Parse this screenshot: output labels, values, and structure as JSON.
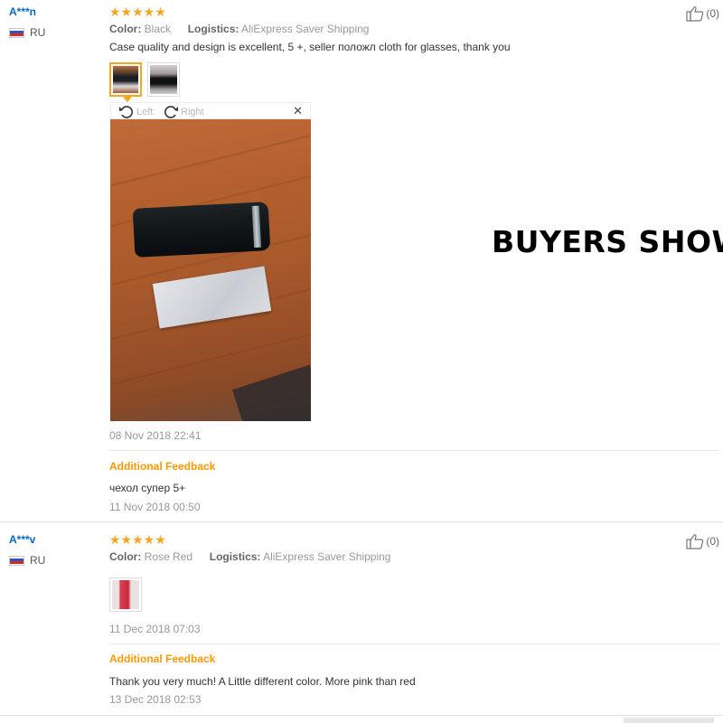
{
  "headline": "BUYERS SHOW",
  "labels": {
    "color": "Color:",
    "logistics": "Logistics:",
    "additional_feedback": "Additional Feedback",
    "rotate_left": "Left",
    "rotate_right": "Right"
  },
  "reviews": [
    {
      "user": "A***n",
      "country": "RU",
      "rating": 5,
      "stars": "★★★★★",
      "color_value": "Black",
      "logistics_value": "AliExpress Saver Shipping",
      "comment": "Case quality and design is excellent, 5 +, seller положл cloth for glasses, thank you",
      "date": "08 Nov 2018 22:41",
      "additional_comment": "чехол супер 5+",
      "additional_date": "11 Nov 2018 00:50",
      "likes": "(0)"
    },
    {
      "user": "A***v",
      "country": "RU",
      "rating": 5,
      "stars": "★★★★★",
      "color_value": "Rose Red",
      "logistics_value": "AliExpress Saver Shipping",
      "comment": "",
      "date": "11 Dec 2018 07:03",
      "additional_comment": "Thank you very much! A Little different color. More pink than red",
      "additional_date": "13 Dec 2018 02:53",
      "likes": "(0)"
    }
  ],
  "icons": {
    "like": "thumbs-up-icon",
    "rotate_left": "rotate-left-icon",
    "rotate_right": "rotate-right-icon",
    "close": "close-icon",
    "flag": "russia-flag-icon"
  },
  "colors": {
    "username": "#0066cc",
    "stars": "#f5a623",
    "additional_feedback": "#ff9900"
  }
}
